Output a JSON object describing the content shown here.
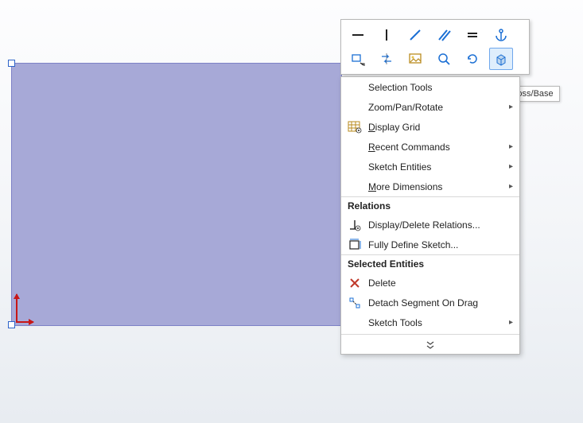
{
  "tooltip": "Extruded Boss/Base",
  "toolbar": {
    "row1": [
      "horizontal-line",
      "vertical-line",
      "diagonal-line",
      "hatch-diagonal",
      "equals",
      "anchor"
    ],
    "row2": [
      "smart-dimension",
      "flip",
      "image-frame",
      "magnify",
      "rotate-sketch",
      "extrude-boss"
    ]
  },
  "menu": {
    "selection_tools": "Selection Tools",
    "zoom_pan_rotate": "Zoom/Pan/Rotate",
    "display_grid": "Display Grid",
    "recent_commands": "Recent Commands",
    "sketch_entities": "Sketch Entities",
    "more_dimensions": "More Dimensions",
    "relations_header": "Relations",
    "display_delete_relations": "Display/Delete Relations...",
    "fully_define_sketch": "Fully Define Sketch...",
    "selected_entities_header": "Selected Entities",
    "delete": "Delete",
    "detach_segment": "Detach Segment On Drag",
    "sketch_tools": "Sketch Tools"
  },
  "accel": {
    "display_grid_key": "D",
    "recent_commands_key": "R",
    "more_dimensions_key": "M"
  }
}
